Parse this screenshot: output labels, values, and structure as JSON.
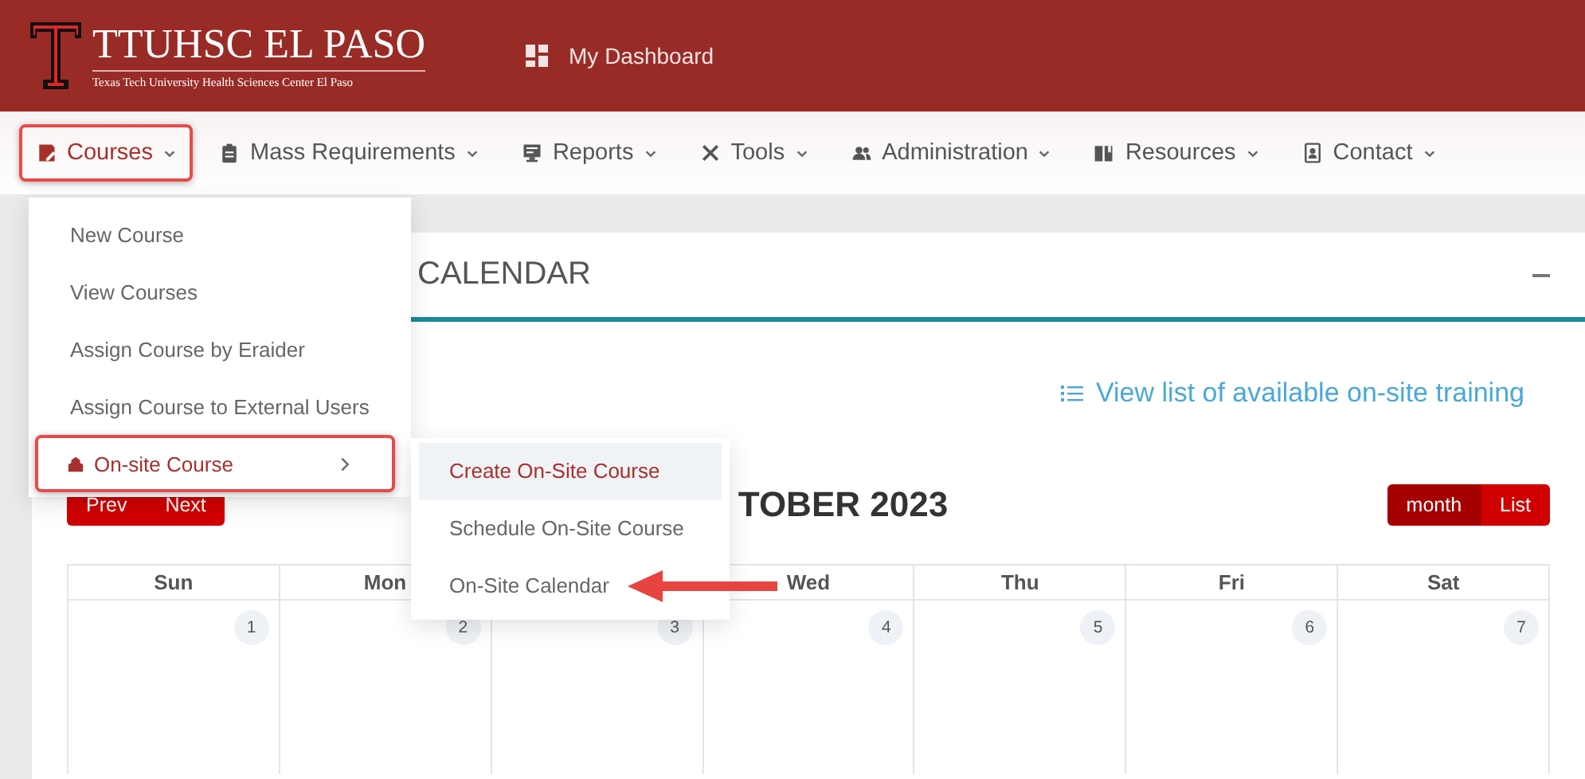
{
  "header": {
    "logo_title": "TTUHSC EL PASO",
    "logo_subtitle": "Texas Tech University Health Sciences Center El Paso",
    "dashboard_link": "My Dashboard"
  },
  "nav": [
    {
      "label": "Courses",
      "selected": true,
      "highlighted": true
    },
    {
      "label": "Mass Requirements",
      "selected": false,
      "highlighted": false
    },
    {
      "label": "Reports",
      "selected": false,
      "highlighted": false
    },
    {
      "label": "Tools",
      "selected": false,
      "highlighted": false
    },
    {
      "label": "Administration",
      "selected": false,
      "highlighted": false
    },
    {
      "label": "Resources",
      "selected": false,
      "highlighted": false
    },
    {
      "label": "Contact",
      "selected": false,
      "highlighted": false
    }
  ],
  "courses_menu": [
    {
      "label": "New Course",
      "kind": "link",
      "highlighted": false
    },
    {
      "label": "View Courses",
      "kind": "link",
      "highlighted": false
    },
    {
      "label": "Assign Course by Eraider",
      "kind": "link",
      "highlighted": false
    },
    {
      "label": "Assign Course to External Users",
      "kind": "link",
      "highlighted": false
    },
    {
      "label": "On-site Course",
      "kind": "submenu",
      "highlighted": true
    }
  ],
  "submenu": [
    {
      "label": "Create On-Site Course",
      "selected": true,
      "pointed": false
    },
    {
      "label": "Schedule On-Site Course",
      "selected": false,
      "pointed": false
    },
    {
      "label": "On-Site Calendar",
      "selected": false,
      "pointed": true
    }
  ],
  "card": {
    "title": "CALENDAR",
    "list_link": "View list of available on-site training",
    "nav_buttons": [
      "Prev",
      "Next"
    ],
    "month_title": "TOBER 2023",
    "views": [
      {
        "label": "month",
        "selected": true
      },
      {
        "label": "List",
        "selected": false
      }
    ],
    "weekdays": [
      {
        "label": "Sun"
      },
      {
        "label": "Mon"
      },
      {
        "label": "Wed",
        "covered_column_before": true
      },
      {
        "label": "Thu"
      },
      {
        "label": "Fri"
      },
      {
        "label": "Sat"
      }
    ],
    "dates": [
      "1",
      "2",
      "3",
      "4",
      "5",
      "6",
      "7"
    ]
  }
}
